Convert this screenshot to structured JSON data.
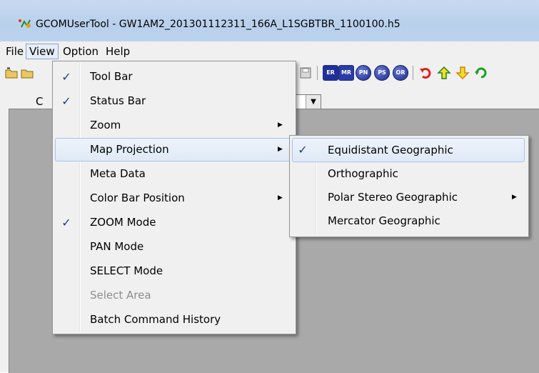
{
  "window": {
    "title": "GCOMUserTool - GW1AM2_201301112311_166A_L1SGBTBR_1100100.h5"
  },
  "menubar": {
    "items": [
      {
        "label": "File"
      },
      {
        "label": "View"
      },
      {
        "label": "Option"
      },
      {
        "label": "Help"
      }
    ]
  },
  "toolbar": {
    "buttons": [
      "ER",
      "MR",
      "PN",
      "PS",
      "OR"
    ]
  },
  "partial_label": "C",
  "view_menu": {
    "items": [
      {
        "label": "Tool Bar",
        "checked": true
      },
      {
        "label": "Status Bar",
        "checked": true
      },
      {
        "label": "Zoom",
        "submenu": true
      },
      {
        "label": "Map Projection",
        "submenu": true,
        "highlighted": true
      },
      {
        "label": "Meta Data"
      },
      {
        "label": "Color Bar Position",
        "submenu": true
      },
      {
        "label": "ZOOM Mode",
        "checked": true
      },
      {
        "label": "PAN Mode"
      },
      {
        "label": "SELECT Mode"
      },
      {
        "label": "Select Area",
        "disabled": true
      },
      {
        "label": "Batch Command History"
      }
    ]
  },
  "projection_menu": {
    "items": [
      {
        "label": "Equidistant Geographic",
        "checked": true,
        "highlighted": true
      },
      {
        "label": "Orthographic"
      },
      {
        "label": "Polar Stereo Geographic",
        "submenu": true
      },
      {
        "label": "Mercator Geographic"
      }
    ]
  },
  "glyphs": {
    "check": "✓",
    "submenu_arrow": "▶",
    "combo_arrow": "▼"
  },
  "colors": {
    "accent_check": "#1a3c8c",
    "client_bg": "#a9a9a9",
    "menu_highlight": "#dfe9f6"
  }
}
